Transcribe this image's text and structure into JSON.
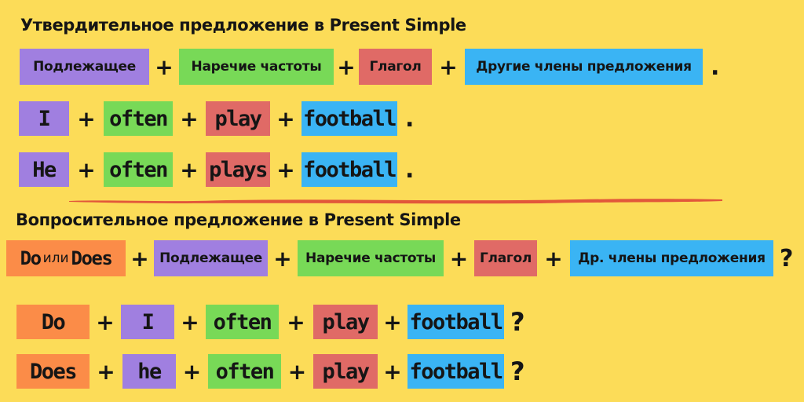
{
  "affirmative": {
    "title": "Утвердительное предложение в Present Simple",
    "formula": {
      "subject": "Подлежащее",
      "adverb": "Наречие частоты",
      "verb": "Глагол",
      "other": "Другие члены предложения",
      "end": "."
    },
    "examples": [
      {
        "subject": "I",
        "adverb": "often",
        "verb": "play",
        "object": "football",
        "end": "."
      },
      {
        "subject": "He",
        "adverb": "often",
        "verb": "plays",
        "object": "football",
        "end": "."
      }
    ]
  },
  "interrogative": {
    "title": "Вопросительное предложение в Present Simple",
    "formula": {
      "aux_do": "Do",
      "aux_or": "или",
      "aux_does": "Does",
      "subject": "Подлежащее",
      "adverb": "Наречие частоты",
      "verb": "Глагол",
      "other": "Др. члены предложения",
      "end": "?"
    },
    "examples": [
      {
        "aux": "Do",
        "subject": "I",
        "adverb": "often",
        "verb": "play",
        "object": "football",
        "end": "?"
      },
      {
        "aux": "Does",
        "subject": "he",
        "adverb": "often",
        "verb": "play",
        "object": "football",
        "end": "?"
      }
    ]
  },
  "plus": "+",
  "colors": {
    "background": "#fcdc58",
    "subject": "#a07fe0",
    "adverb": "#78d957",
    "verb": "#e06a66",
    "other": "#3ab4f4",
    "auxiliary": "#fb8c48",
    "divider": "#e2573a"
  }
}
